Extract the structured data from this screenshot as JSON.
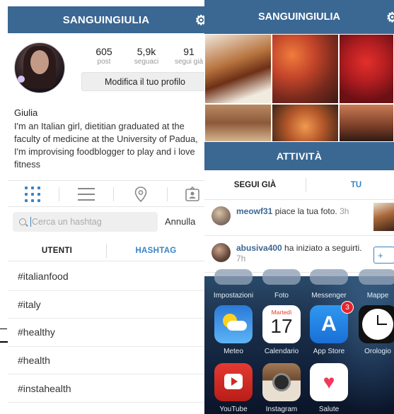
{
  "left": {
    "header": {
      "title": "SANGUINGIULIA"
    },
    "stats": [
      {
        "value": "605",
        "label": "post"
      },
      {
        "value": "5,9k",
        "label": "seguaci"
      },
      {
        "value": "91",
        "label": "segui già"
      }
    ],
    "edit_profile_label": "Modifica il tuo profilo",
    "name": "Giulia",
    "bio": "I'm an Italian girl, dietitian graduated at the faculty of medicine at the University of Padua, I'm improvising foodblogger to play and i love fitness",
    "search": {
      "placeholder": "Cerca un hashtag",
      "cancel_label": "Annulla"
    },
    "tabs": [
      {
        "label": "UTENTI"
      },
      {
        "label": "HASHTAG"
      }
    ],
    "hashtags": [
      "#italianfood",
      "#italy",
      "#healthy",
      "#health",
      "#instahealth"
    ]
  },
  "right": {
    "header": {
      "title": "SANGUINGIULIA"
    },
    "activity_bar": "ATTIVITÀ",
    "tabs": [
      {
        "label": "SEGUI GIÀ"
      },
      {
        "label": "TU"
      }
    ],
    "activities": [
      {
        "user": "meowf31",
        "action": " piace la tua foto.",
        "time": " 3h"
      },
      {
        "user": "abusiva400",
        "action": " ha iniziato a seguirti.",
        "time": " 7h"
      }
    ],
    "follow_label": "+",
    "ios": {
      "top_row": [
        "Impostazioni",
        "Foto",
        "Messenger",
        "Mappe"
      ],
      "apps_row1": [
        {
          "label": "Meteo",
          "icon": "weather-icon"
        },
        {
          "label": "Calendario",
          "icon": "calendar-icon",
          "day": "Martedì",
          "date": "17"
        },
        {
          "label": "App Store",
          "icon": "app-store-icon",
          "badge": "3"
        },
        {
          "label": "Orologio",
          "icon": "clock-icon"
        }
      ],
      "apps_row2": [
        {
          "label": "YouTube",
          "icon": "youtube-icon"
        },
        {
          "label": "Instagram",
          "icon": "instagram-icon"
        },
        {
          "label": "Salute",
          "icon": "health-icon"
        }
      ]
    }
  }
}
